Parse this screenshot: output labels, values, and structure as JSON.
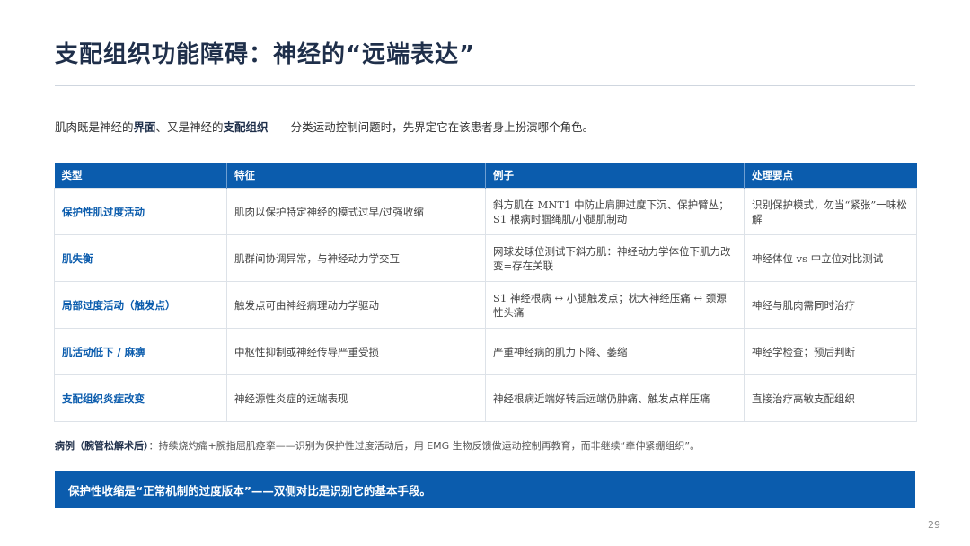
{
  "title": "支配组织功能障碍：神经的“远端表达”",
  "intro": {
    "p1": "肌肉既是神经的",
    "b1": "界面",
    "p2": "、又是神经的",
    "b2": "支配组织",
    "p3": "——分类运动控制问题时，先界定它在该患者身上扮演哪个角色。"
  },
  "table": {
    "headers": [
      "类型",
      "特征",
      "例子",
      "处理要点"
    ],
    "rows": [
      [
        "保护性肌过度活动",
        "肌肉以保护特定神经的模式过早/过强收缩",
        "斜方肌在 MNT1 中防止肩胛过度下沉、保护臂丛；S1 根病时腘绳肌/小腿肌制动",
        "识别保护模式，勿当“紧张”一味松解"
      ],
      [
        "肌失衡",
        "肌群间协调异常，与神经动力学交互",
        "网球发球位测试下斜方肌：神经动力学体位下肌力改变=存在关联",
        "神经体位 vs 中立位对比测试"
      ],
      [
        "局部过度活动（触发点）",
        "触发点可由神经病理动力学驱动",
        "S1 神经根病 ↔ 小腿触发点；枕大神经压痛 ↔ 颈源性头痛",
        "神经与肌肉需同时治疗"
      ],
      [
        "肌活动低下 / 麻痹",
        "中枢性抑制或神经传导严重受损",
        "严重神经病的肌力下降、萎缩",
        "神经学检查；预后判断"
      ],
      [
        "支配组织炎症改变",
        "神经源性炎症的远端表现",
        "神经根病近端好转后远端仍肿痛、触发点样压痛",
        "直接治疗高敏支配组织"
      ]
    ]
  },
  "case": {
    "label": "病例（腕管松解术后）",
    "text": "：持续烧灼痛+腕指屈肌痉挛——识别为保护性过度活动后，用 EMG 生物反馈做运动控制再教育，而非继续“牵伸紧绷组织”。"
  },
  "banner": "保护性收缩是“正常机制的过度版本”——双侧对比是识别它的基本手段。",
  "page_number": "29"
}
